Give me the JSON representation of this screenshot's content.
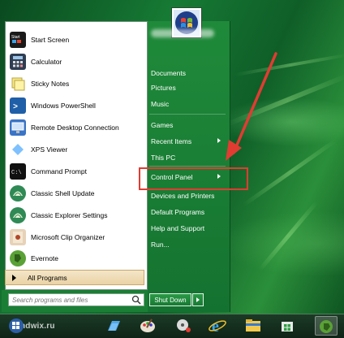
{
  "start_menu": {
    "programs": [
      {
        "label": "Start Screen",
        "icon": "start-screen-icon",
        "color": "#1a1a1a"
      },
      {
        "label": "Calculator",
        "icon": "calculator-icon",
        "color": "#2e3d52"
      },
      {
        "label": "Sticky Notes",
        "icon": "sticky-notes-icon",
        "color": "#e8d66a"
      },
      {
        "label": "Windows PowerShell",
        "icon": "powershell-icon",
        "color": "#1e5fa8"
      },
      {
        "label": "Remote Desktop Connection",
        "icon": "remote-desktop-icon",
        "color": "#3a74c6"
      },
      {
        "label": "XPS Viewer",
        "icon": "xps-viewer-icon",
        "color": "#2e7fd0"
      },
      {
        "label": "Command Prompt",
        "icon": "command-prompt-icon",
        "color": "#111111"
      },
      {
        "label": "Classic Shell Update",
        "icon": "classic-shell-icon",
        "color": "#2f8a55"
      },
      {
        "label": "Classic Explorer Settings",
        "icon": "classic-explorer-icon",
        "color": "#2f8a55"
      },
      {
        "label": "Microsoft Clip Organizer",
        "icon": "clip-organizer-icon",
        "color": "#b0472a"
      },
      {
        "label": "Evernote",
        "icon": "evernote-icon",
        "color": "#5aa136"
      }
    ],
    "all_programs_label": "All Programs",
    "search_placeholder": "Search programs and files",
    "right_items": [
      {
        "label": "Documents",
        "has_arrow": false
      },
      {
        "label": "Pictures",
        "has_arrow": false
      },
      {
        "label": "Music",
        "has_arrow": false
      },
      {
        "label": "Games",
        "has_arrow": false
      },
      {
        "label": "Recent Items",
        "has_arrow": true
      },
      {
        "label": "This PC",
        "has_arrow": false
      },
      {
        "label": "Control Panel",
        "has_arrow": true
      },
      {
        "label": "Devices and Printers",
        "has_arrow": false
      },
      {
        "label": "Default Programs",
        "has_arrow": false
      },
      {
        "label": "Help and Support",
        "has_arrow": false
      },
      {
        "label": "Run...",
        "has_arrow": false
      }
    ],
    "shutdown_label": "Shut Down"
  },
  "taskbar": {
    "watermark": "windwix.ru",
    "apps": [
      "start-orb-icon",
      "tiles-icon",
      "paint-icon",
      "media-icon",
      "internet-explorer-icon",
      "file-explorer-icon",
      "store-icon",
      "evernote-icon"
    ]
  },
  "colors": {
    "menu_green": "#1a7f35",
    "highlight_red": "#e23b32"
  }
}
